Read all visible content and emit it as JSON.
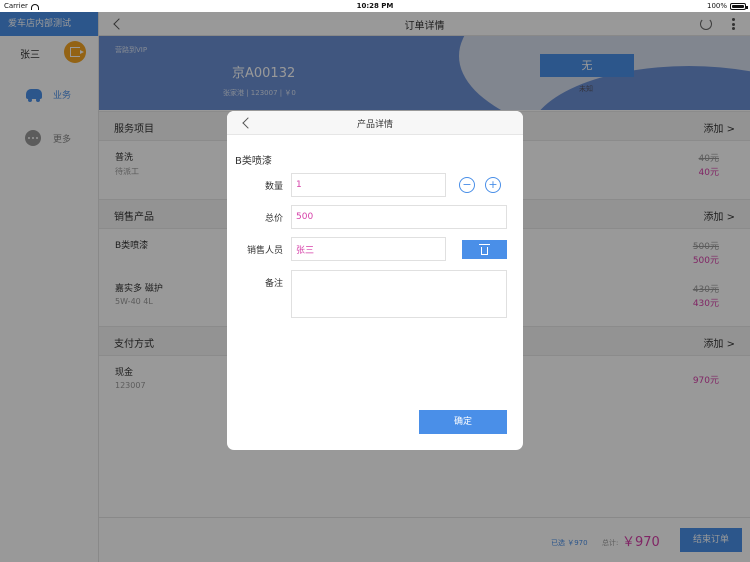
{
  "status_bar": {
    "carrier": "Carrier",
    "time": "10:28 PM",
    "battery": "100%"
  },
  "sidebar": {
    "store_name": "爱车店内部测试",
    "user_name": "张三",
    "nav": [
      {
        "label": "业务",
        "icon": "car-icon",
        "active": true
      },
      {
        "label": "更多",
        "icon": "more-icon",
        "active": false
      }
    ]
  },
  "header": {
    "title": "订单详情"
  },
  "banner": {
    "vip_label": "营路到VIP",
    "plate": "京A00132",
    "owner_info": "张家港 | 123007 | ￥0",
    "grade": "无",
    "grade_sub": "未知"
  },
  "sections": {
    "services": {
      "title": "服务项目",
      "add": "添加 >",
      "items": [
        {
          "name": "普洗",
          "sub": "待派工",
          "price_old": "40元",
          "price": "40元"
        }
      ]
    },
    "products": {
      "title": "销售产品",
      "add": "添加 >",
      "items": [
        {
          "name": "B类喷漆",
          "sub": "",
          "price_old": "500元",
          "price": "500元"
        },
        {
          "name": "嘉实多 磁护",
          "sub": "5W-40 4L",
          "price_old": "430元",
          "price": "430元"
        }
      ]
    },
    "payment": {
      "title": "支付方式",
      "add": "添加 >",
      "items": [
        {
          "name": "现金",
          "sub": "123007",
          "price": "970元"
        }
      ]
    }
  },
  "footer": {
    "selected": "已选 ￥970",
    "total_label": "总计:",
    "total_value": "￥970",
    "end_order": "结束订单"
  },
  "modal": {
    "title": "产品详情",
    "product_name": "B类喷漆",
    "fields": {
      "quantity": {
        "label": "数量",
        "value": "1"
      },
      "total_price": {
        "label": "总价",
        "value": "500"
      },
      "salesperson": {
        "label": "销售人员",
        "value": "张三"
      },
      "remark": {
        "label": "备注",
        "value": ""
      }
    },
    "confirm": "确定"
  },
  "colors": {
    "accent": "#4a8fe8",
    "price": "#d63fa8",
    "logout": "#f5a623",
    "banner": "#6b8fd4"
  }
}
